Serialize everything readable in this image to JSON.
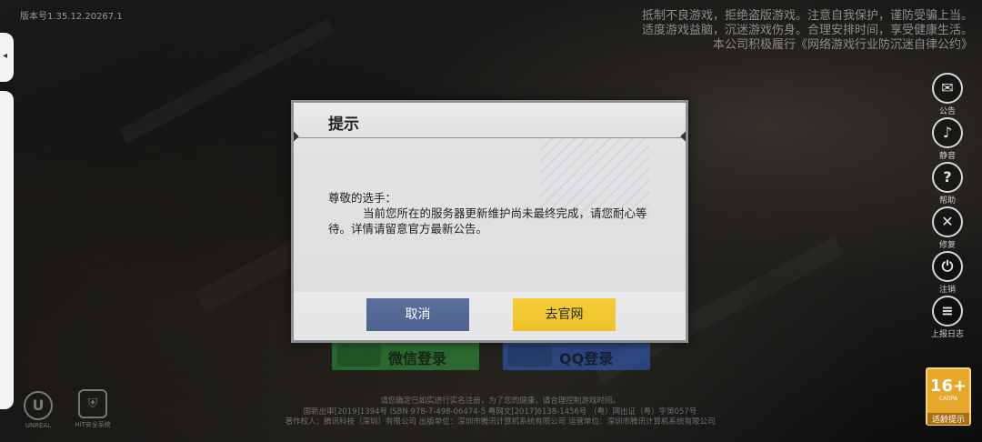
{
  "version": "版本号1.35.12.20267.1",
  "notice": [
    "抵制不良游戏，拒绝盗版游戏。注意自我保护，谨防受骗上当。",
    "适度游戏益脑，沉迷游戏伤身。合理安排时间，享受健康生活。",
    "本公司积极履行《网络游戏行业防沉迷自律公约》"
  ],
  "side_buttons": [
    {
      "icon": "megaphone-icon",
      "label": "公告"
    },
    {
      "icon": "speaker-icon",
      "label": "静音"
    },
    {
      "icon": "help-icon",
      "label": "帮助"
    },
    {
      "icon": "repair-icon",
      "label": "修复"
    },
    {
      "icon": "power-icon",
      "label": "注销"
    },
    {
      "icon": "report-log-icon",
      "label": "上报日志"
    }
  ],
  "login_buttons": {
    "wechat": "微信登录",
    "qq": "QQ登录"
  },
  "footer_lines": [
    "请您确定已如实进行实名注册，为了您的健康，请合理控制游戏时间。",
    "国新出审[2019]1394号  ISBN 978-7-498-06474-5  粤网文[2017]6138-1456号  （粤）网出证（粤）字第057号",
    "著作权人：腾讯科技（深圳）有限公司    出版单位：深圳市腾讯计算机系统有限公司    运营单位：深圳市腾讯计算机系统有限公司"
  ],
  "logos": {
    "unreal": "UNREAL",
    "security": "HiT安全系统"
  },
  "age_rating": {
    "number": "16+",
    "sub": "CADPA",
    "label": "适龄提示"
  },
  "dialog": {
    "title": "提示",
    "greeting": "尊敬的选手：",
    "message": "当前您所在的服务器更新维护尚未最终完成，请您耐心等待。详情请留意官方最新公告。",
    "cancel_label": "取消",
    "go_label": "去官网"
  },
  "colors": {
    "cancel_button": "#4e6290",
    "go_button": "#eec02a",
    "wechat": "#2fa43f",
    "qq": "#2f63c9",
    "age_badge": "#e5a82c"
  }
}
